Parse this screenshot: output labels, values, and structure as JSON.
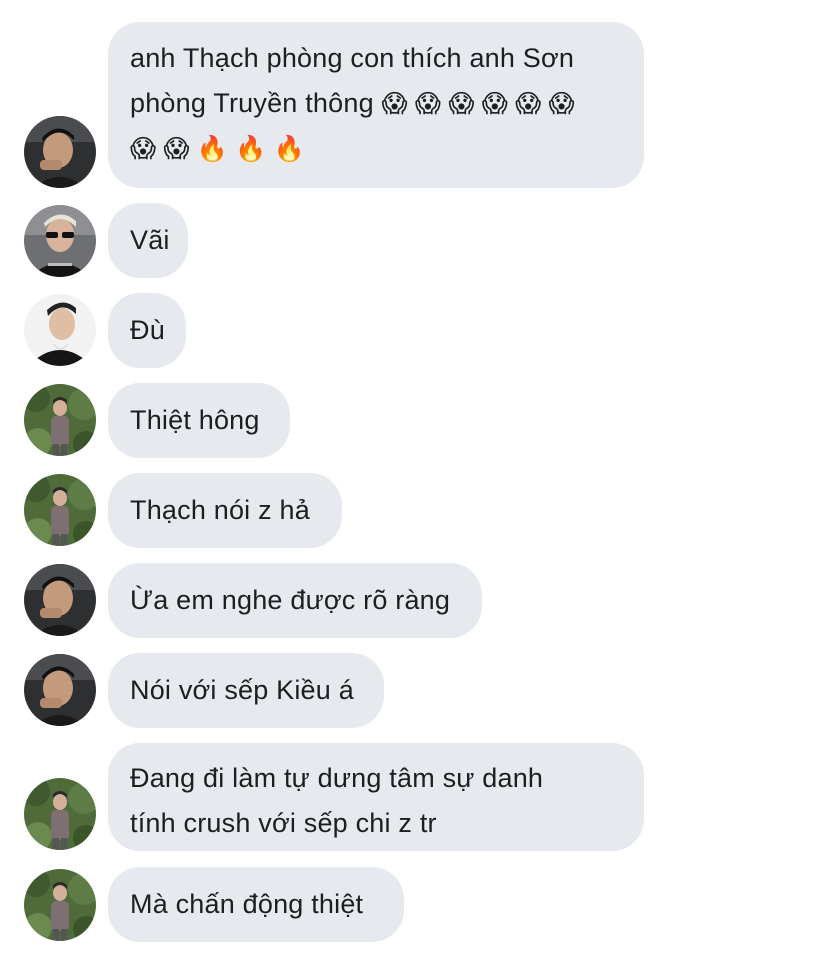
{
  "messages": [
    {
      "sender": "photo-dark",
      "lines": [
        "anh Thạch phòng con thích anh Sơn",
        "phòng Truyền thông"
      ],
      "emoji_line_1": "😱 😱 😱 😱 😱 😱",
      "emoji_line_2": "😱 😱 🔥 🔥 🔥"
    },
    {
      "sender": "photo-sunglasses",
      "text": "Vãi"
    },
    {
      "sender": "photo-black-shirt",
      "text": "Đù"
    },
    {
      "sender": "photo-garden",
      "text": "Thiệt hông"
    },
    {
      "sender": "photo-garden",
      "text": "Thạch nói z hả"
    },
    {
      "sender": "photo-dark",
      "text": "Ừa em nghe được rõ ràng"
    },
    {
      "sender": "photo-dark",
      "text": "Nói với sếp Kiều á"
    },
    {
      "sender": "photo-garden",
      "lines": [
        "Đang đi làm tự dưng tâm sự danh",
        "tính crush với sếp chi z tr"
      ]
    },
    {
      "sender": "photo-garden",
      "text": "Mà chấn động thiệt"
    }
  ],
  "colors": {
    "bubble": "#e6e9ee",
    "text": "#1c1e21",
    "background": "#ffffff"
  }
}
